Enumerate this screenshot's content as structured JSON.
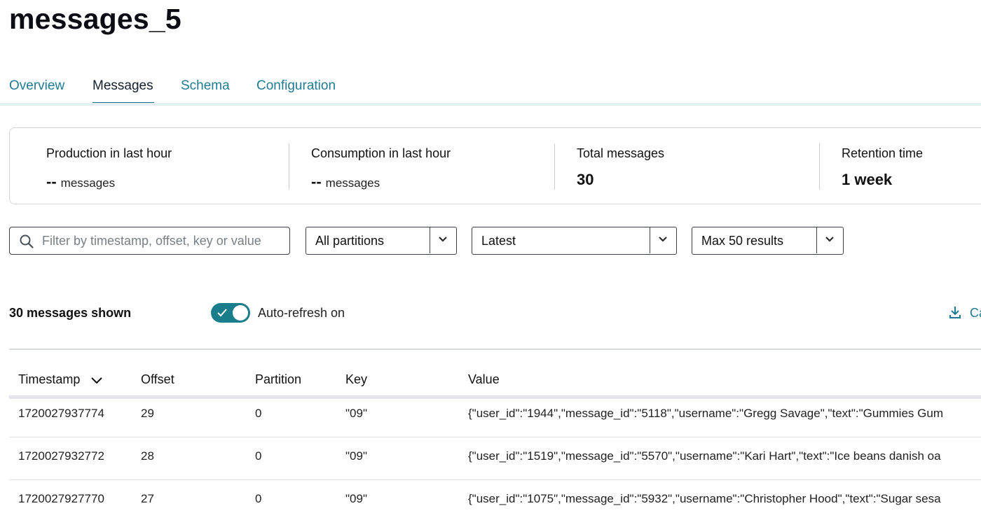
{
  "header": {
    "title": "messages_5"
  },
  "tabs": [
    {
      "label": "Overview"
    },
    {
      "label": "Messages",
      "active": true
    },
    {
      "label": "Schema"
    },
    {
      "label": "Configuration"
    }
  ],
  "stats": {
    "production": {
      "label": "Production in last hour",
      "value": "--",
      "unit": "messages"
    },
    "consumption": {
      "label": "Consumption in last hour",
      "value": "--",
      "unit": "messages"
    },
    "total": {
      "label": "Total messages",
      "value": "30"
    },
    "retention": {
      "label": "Retention time",
      "value": "1 week"
    }
  },
  "filters": {
    "search_placeholder": "Filter by timestamp, offset, key or value",
    "partition_select": "All partitions",
    "position_select": "Latest",
    "limit_select": "Max 50 results"
  },
  "status": {
    "shown": "30 messages shown",
    "auto_refresh_label": "Auto-refresh on",
    "auto_refresh_on": true,
    "download_label": "Ca"
  },
  "table": {
    "columns": [
      "Timestamp",
      "Offset",
      "Partition",
      "Key",
      "Value"
    ],
    "sorted_column": "Timestamp",
    "rows": [
      {
        "timestamp": "1720027937774",
        "offset": "29",
        "partition": "0",
        "key": "\"09\"",
        "value": "{\"user_id\":\"1944\",\"message_id\":\"5118\",\"username\":\"Gregg Savage\",\"text\":\"Gummies Gum"
      },
      {
        "timestamp": "1720027932772",
        "offset": "28",
        "partition": "0",
        "key": "\"09\"",
        "value": "{\"user_id\":\"1519\",\"message_id\":\"5570\",\"username\":\"Kari Hart\",\"text\":\"Ice beans danish oa"
      },
      {
        "timestamp": "1720027927770",
        "offset": "27",
        "partition": "0",
        "key": "\"09\"",
        "value": "{\"user_id\":\"1075\",\"message_id\":\"5932\",\"username\":\"Christopher Hood\",\"text\":\"Sugar sesa"
      }
    ]
  },
  "colors": {
    "accent": "#1f7a94",
    "toggle": "#1a7d8c",
    "tab_underline": "#1b6f85"
  },
  "icons": {
    "search": "search-icon",
    "chevron": "chevron-down-icon",
    "download": "download-icon",
    "check": "check-icon"
  }
}
